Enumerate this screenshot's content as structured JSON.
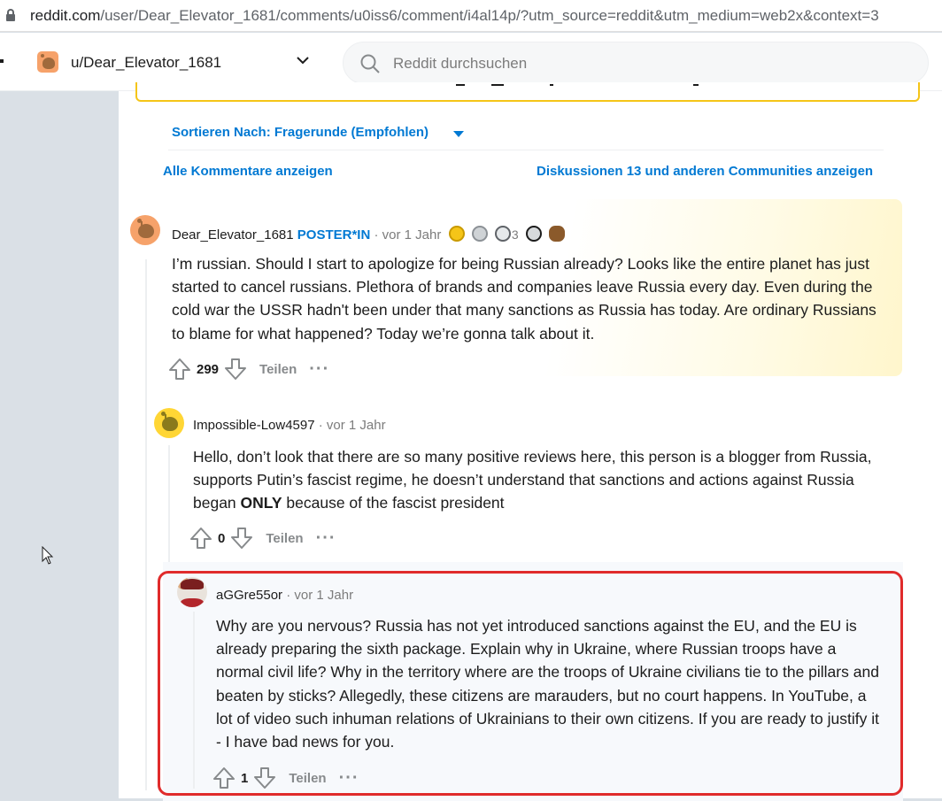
{
  "browser": {
    "url_host": "reddit.com",
    "url_path": "/user/Dear_Elevator_1681/comments/u0iss6/comment/i4al14p/?utm_source=reddit&utm_medium=web2x&context=3"
  },
  "header": {
    "username": "u/Dear_Elevator_1681",
    "search_placeholder": "Reddit durchsuchen"
  },
  "controls": {
    "sort_label": "Sortieren Nach: Fragerunde (Empfohlen)",
    "all_comments": "Alle Kommentare anzeigen",
    "other_discussions": "Diskussionen 13 und anderen Communities anzeigen"
  },
  "comments": [
    {
      "author": "Dear_Elevator_1681",
      "flair": "POSTER*IN",
      "sep": "·",
      "time": "vor 1 Jahr",
      "award_count": "3",
      "body": "I’m russian. Should I start to apologize for being Russian already? Looks like the entire planet has just started to cancel russians. Plethora of brands and companies leave Russia every day. Even during the cold war the USSR hadn't been under that many sanctions as Russia has today. Are ordinary Russians to blame for what happened? Today we’re gonna talk about it.",
      "score": "299",
      "share": "Teilen",
      "more": "···"
    },
    {
      "author": "Impossible-Low4597",
      "sep": "·",
      "time": "vor 1 Jahr",
      "body_before": "Hello, don’t look that there are so many positive reviews here, this person is a blogger from Russia, supports Putin’s fascist regime, he doesn’t understand that sanctions and actions against Russia began ",
      "body_bold": "ONLY",
      "body_after": " because of the fascist president",
      "score": "0",
      "share": "Teilen",
      "more": "···"
    },
    {
      "author": "aGGre55or",
      "sep": "·",
      "time": "vor 1 Jahr",
      "body": "Why are you nervous? Russia has not yet introduced sanctions against the EU, and the EU is already preparing the sixth package. Explain why in Ukraine, where Russian troops have a normal civil life? Why in the territory where are the troops of Ukraine civilians tie to the pillars and beaten by sticks? Allegedly, these citizens are marauders, but no court happens. In YouTube, a lot of video such inhuman relations of Ukrainians to their own citizens. If you are ready to justify it - I have bad news for you.",
      "score": "1",
      "share": "Teilen",
      "more": "···"
    }
  ],
  "colors": {
    "link_blue": "#0079d3",
    "highlight_red": "#e02b2b",
    "award_yellow": "#f5c518"
  }
}
